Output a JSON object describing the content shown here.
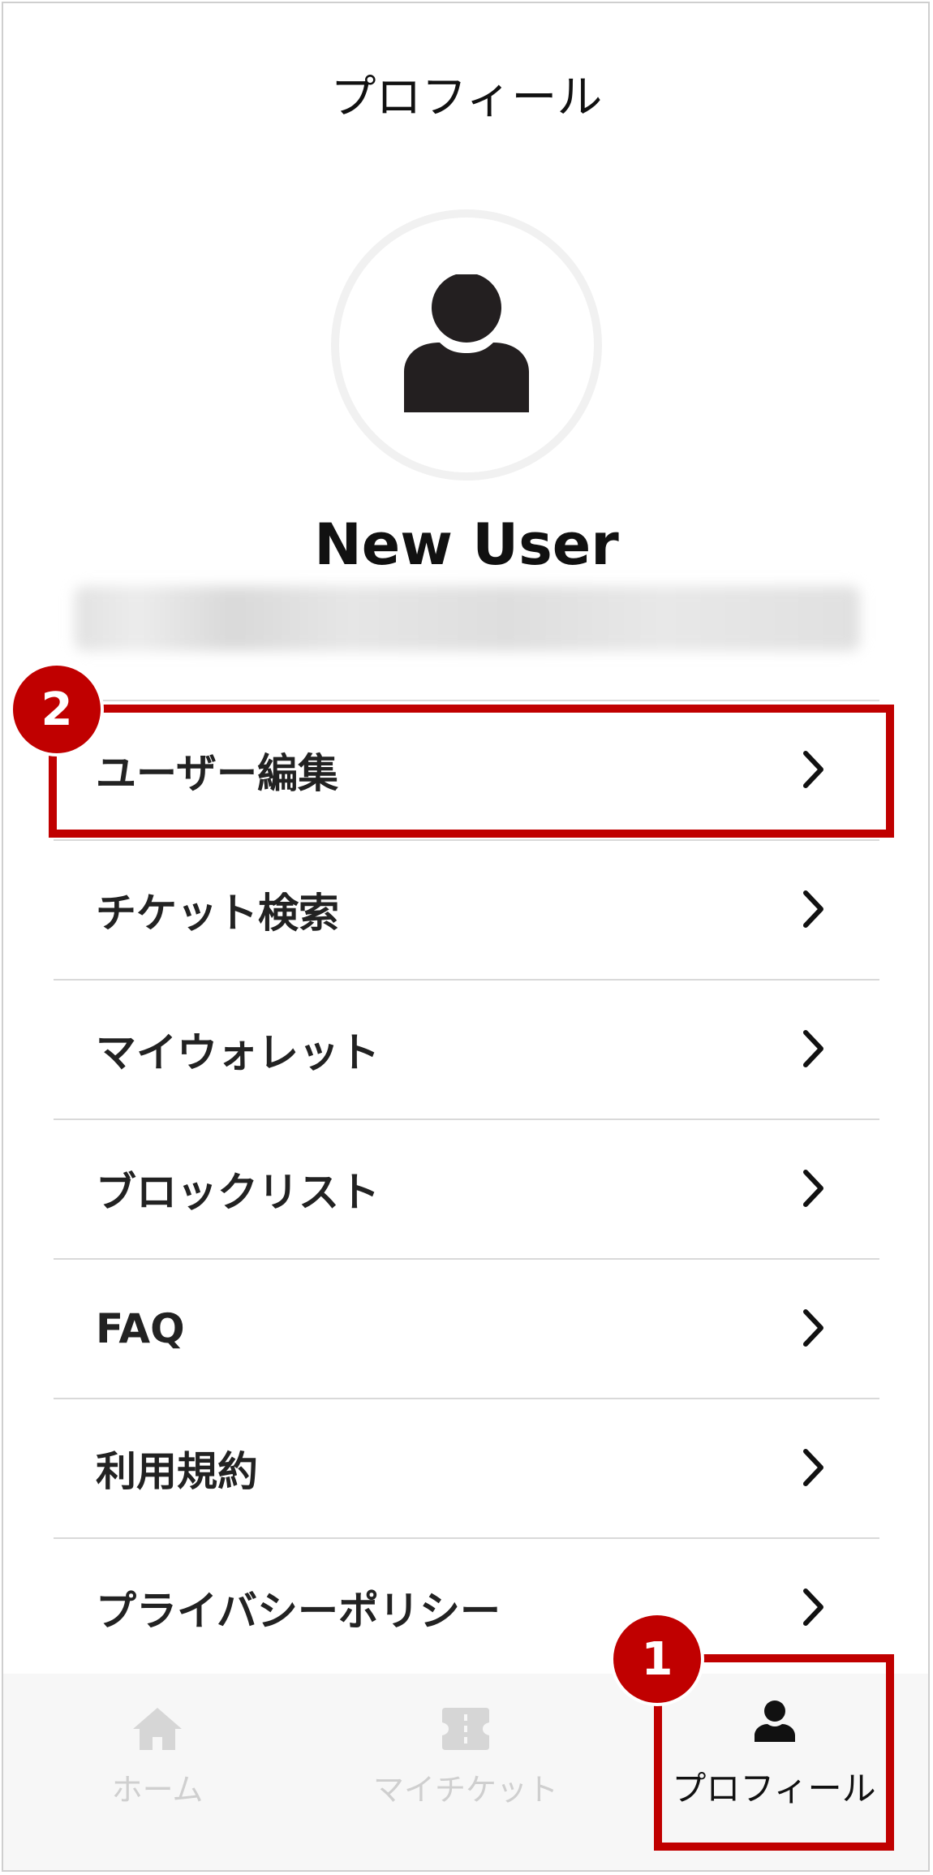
{
  "header": {
    "title": "プロフィール"
  },
  "profile": {
    "name": "New User",
    "email": ""
  },
  "menu": {
    "items": [
      {
        "label": "ユーザー編集"
      },
      {
        "label": "チケット検索"
      },
      {
        "label": "マイウォレット"
      },
      {
        "label": "ブロックリスト"
      },
      {
        "label": "FAQ"
      },
      {
        "label": "利用規約"
      },
      {
        "label": "プライバシーポリシー"
      }
    ]
  },
  "tabbar": {
    "tabs": [
      {
        "label": "ホーム",
        "icon": "home-icon",
        "active": false
      },
      {
        "label": "マイチケット",
        "icon": "ticket-icon",
        "active": false
      },
      {
        "label": "プロフィール",
        "icon": "person-icon",
        "active": true
      }
    ]
  },
  "annotations": {
    "step1": "1",
    "step2": "2",
    "color": "#c00000"
  }
}
